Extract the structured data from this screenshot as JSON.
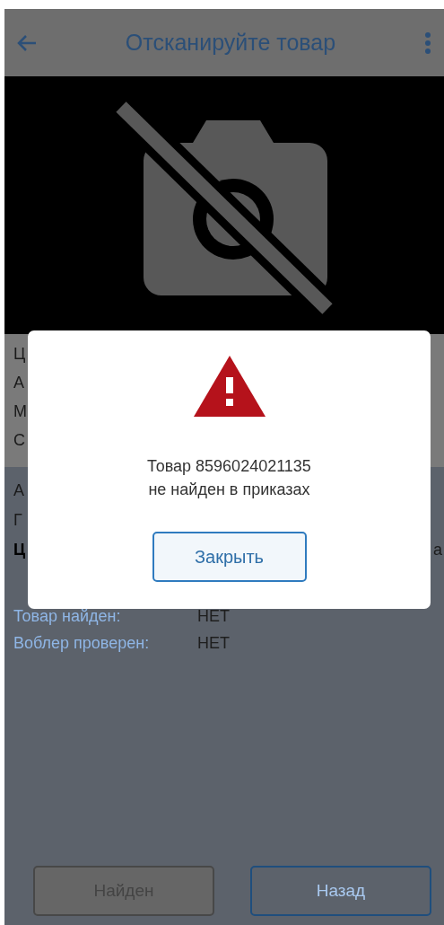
{
  "toolbar": {
    "title": "Отсканируйте товар"
  },
  "camera": {
    "enabled": false
  },
  "details_upper": [
    "Ц",
    "А",
    "М",
    "С"
  ],
  "details_lower": [
    {
      "text": "А",
      "bold": false
    },
    {
      "text": "Г",
      "bold": false
    },
    {
      "text": "Ц",
      "bold": true,
      "trailing": "а"
    }
  ],
  "status": [
    {
      "label": "Товар найден:",
      "value": "НЕТ"
    },
    {
      "label": "Воблер проверен:",
      "value": "НЕТ"
    }
  ],
  "buttons": [
    {
      "label": "Найден",
      "disabled": true
    },
    {
      "label": "Назад",
      "disabled": false
    }
  ],
  "dialog": {
    "kind": "error",
    "message": "Товар 8596024021135\nне найден в приказах",
    "button": "Закрыть"
  }
}
